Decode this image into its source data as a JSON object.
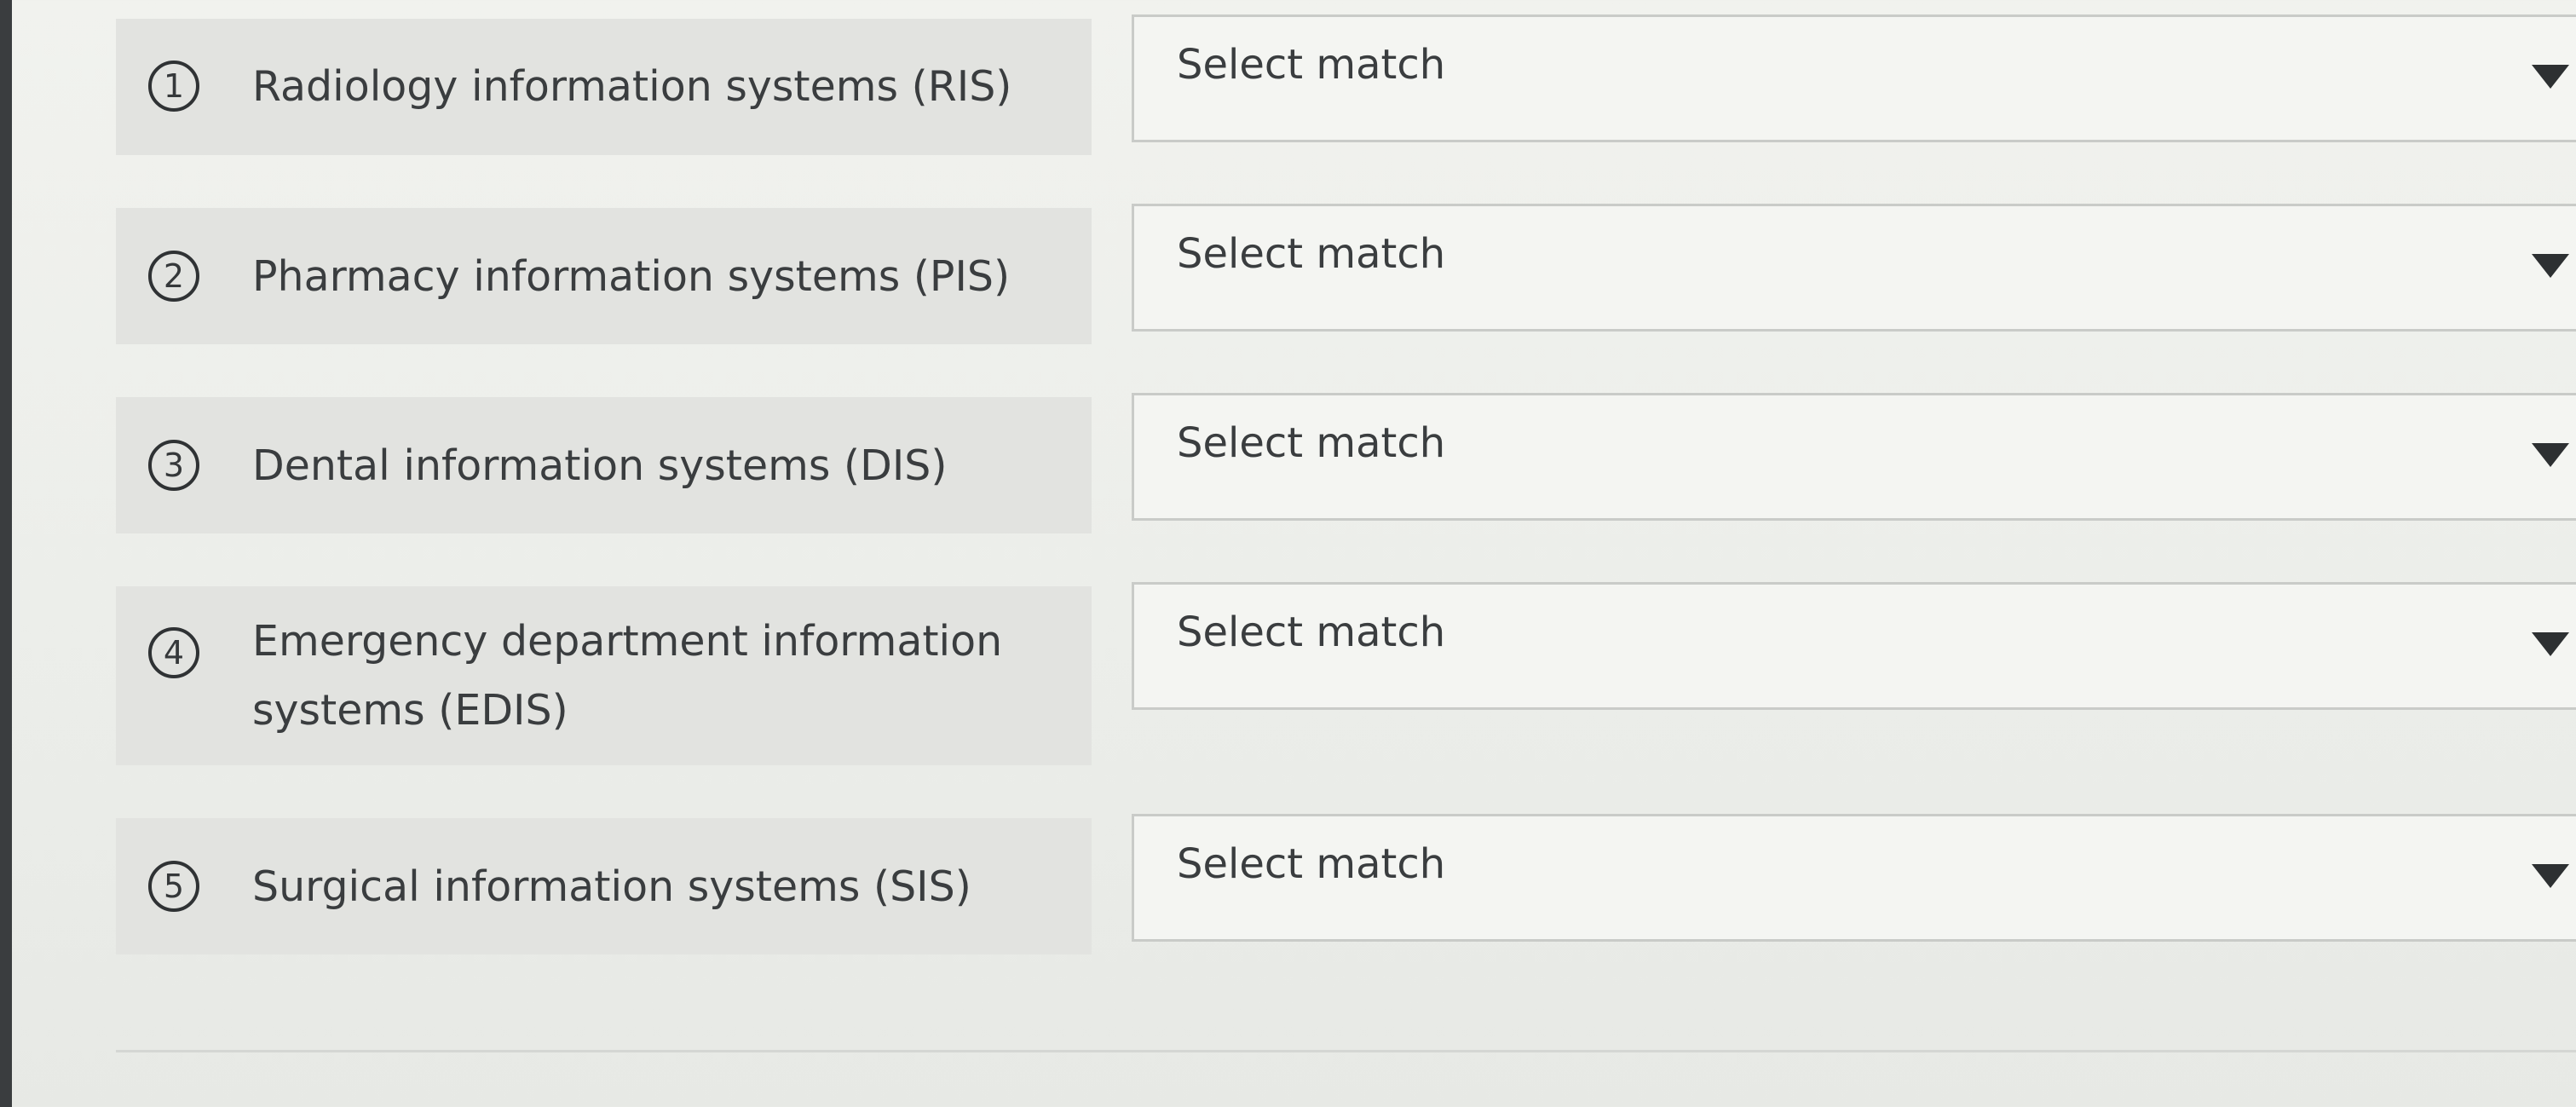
{
  "matching": {
    "items": [
      {
        "number": "1",
        "label": "Radiology information systems (RIS)",
        "selected": "Select match"
      },
      {
        "number": "2",
        "label": "Pharmacy information systems (PIS)",
        "selected": "Select match"
      },
      {
        "number": "3",
        "label": "Dental information systems (DIS)",
        "selected": "Select match"
      },
      {
        "number": "4",
        "label": "Emergency department information systems (EDIS)",
        "selected": "Select match"
      },
      {
        "number": "5",
        "label": "Surgical information systems (SIS)",
        "selected": "Select match"
      }
    ]
  },
  "icons": {
    "dropdown": "triangle-down-icon"
  }
}
